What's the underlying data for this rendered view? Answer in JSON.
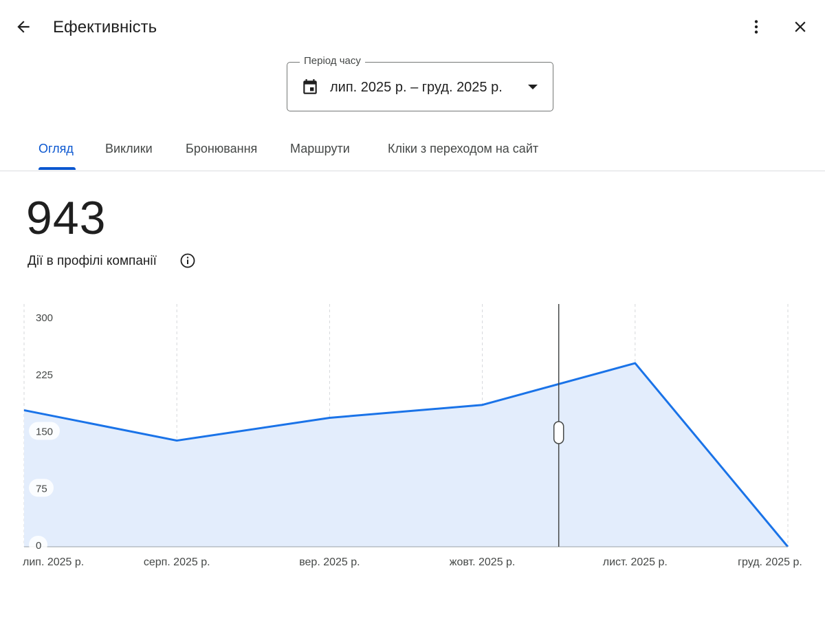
{
  "header": {
    "title": "Ефективність",
    "icons": {
      "back": "arrow-back-icon",
      "more": "more-vert-icon",
      "close": "close-icon"
    }
  },
  "period": {
    "label": "Період часу",
    "value": "лип. 2025 р. – груд. 2025 р.",
    "icon": "calendar-icon",
    "dropdown_icon": "arrow-drop-down-icon"
  },
  "tabs": [
    {
      "label": "Огляд",
      "active": true
    },
    {
      "label": "Виклики",
      "active": false
    },
    {
      "label": "Бронювання",
      "active": false
    },
    {
      "label": "Маршрути",
      "active": false
    },
    {
      "label": "Кліки з переходом на сайт",
      "active": false
    }
  ],
  "metric": {
    "value": "943",
    "label": "Дії в профілі компанії",
    "info_icon": "info-icon"
  },
  "colors": {
    "accent": "#0b57d0",
    "line": "#1a73e8",
    "area": "#e3edfc"
  },
  "chart_data": {
    "type": "area",
    "x": [
      "лип. 2025 р.",
      "серп. 2025 р.",
      "вер. 2025 р.",
      "жовт. 2025 р.",
      "лист. 2025 р.",
      "груд. 2025 р."
    ],
    "series": [
      {
        "values": [
          180,
          140,
          170,
          187,
          242,
          0
        ]
      }
    ],
    "yticks": [
      "300",
      "225",
      "150",
      "75",
      "0"
    ],
    "ylim": [
      0,
      320
    ],
    "grid": "vertical-dashed",
    "cursor_x": 3.5
  }
}
